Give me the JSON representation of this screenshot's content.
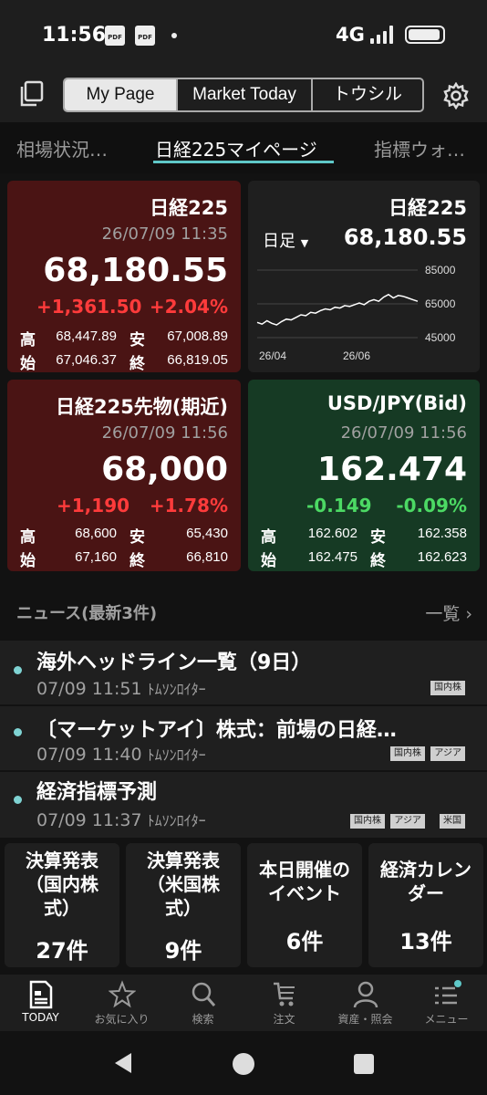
{
  "status_bar": {
    "time": "11:56",
    "network": "4G",
    "pdf_label": "PDF"
  },
  "header": {
    "segments": [
      "My Page",
      "Market Today",
      "トウシル"
    ],
    "active_segment": "My Page"
  },
  "tabs": [
    "相場状況…",
    "日経225マイページ",
    "指標ウォ…"
  ],
  "cards": {
    "nikkei": {
      "name": "日経225",
      "datetime": "26/07/09 11:35",
      "price": "68,180.55",
      "change": "+1,361.50",
      "change_pct": "+2.04%",
      "high_label": "高",
      "high": "68,447.89",
      "low_label": "安",
      "low": "67,008.89",
      "open_label": "始",
      "open": "67,046.37",
      "close_label": "終",
      "close": "66,819.05"
    },
    "nikkei_chart": {
      "name": "日経225",
      "period": "日足",
      "price": "68,180.55",
      "y_ticks": [
        "85000",
        "65000",
        "45000"
      ],
      "x_ticks": [
        "26/04",
        "26/06"
      ]
    },
    "futures": {
      "name": "日経225先物(期近)",
      "datetime": "26/07/09 11:56",
      "price": "68,000",
      "change": "+1,190",
      "change_pct": "+1.78%",
      "high_label": "高",
      "high": "68,600",
      "low_label": "安",
      "low": "65,430",
      "open_label": "始",
      "open": "67,160",
      "close_label": "終",
      "close": "66,810"
    },
    "usdjpy": {
      "name": "USD/JPY(Bid)",
      "datetime": "26/07/09 11:56",
      "price": "162.474",
      "change": "-0.149",
      "change_pct": "-0.09%",
      "high_label": "高",
      "high": "162.602",
      "low_label": "安",
      "low": "162.358",
      "open_label": "始",
      "open": "162.475",
      "close_label": "終",
      "close": "162.623"
    }
  },
  "chart_data": {
    "type": "line",
    "x": [
      "26/04",
      "26/06"
    ],
    "ylim": [
      45000,
      85000
    ],
    "y_ticks": [
      85000,
      65000,
      45000
    ],
    "series": [
      {
        "values": [
          54000,
          53000,
          55000,
          53500,
          52500,
          54500,
          56000,
          55500,
          57000,
          58500,
          58000,
          60000,
          59500,
          61000,
          62000,
          61500,
          63000,
          62500,
          64000,
          63500,
          64500,
          65500,
          64500,
          66500,
          67500,
          66500,
          69000,
          70500,
          68500,
          70000,
          69500,
          68500,
          67500,
          66500
        ]
      }
    ]
  },
  "news": {
    "heading": "ニュース(最新3件)",
    "more": "一覧",
    "items": [
      {
        "title": "海外ヘッドライン一覧（9日）",
        "time": "07/09 11:51",
        "source": "ﾄﾑｿﾝﾛｲﾀｰ",
        "tags": [
          "国内株"
        ]
      },
      {
        "title": "〔マーケットアイ〕株式：前場の日経…",
        "time": "07/09 11:40",
        "source": "ﾄﾑｿﾝﾛｲﾀｰ",
        "tags": [
          "国内株",
          "アジア"
        ]
      },
      {
        "title": "経済指標予測",
        "time": "07/09 11:37",
        "source": "ﾄﾑｿﾝﾛｲﾀｰ",
        "tags": [
          "国内株",
          "アジア",
          "米国"
        ]
      }
    ]
  },
  "tiles": [
    {
      "title": "決算発表\n（国内株\n式）",
      "count": "27件"
    },
    {
      "title": "決算発表\n（米国株\n式）",
      "count": "9件"
    },
    {
      "title": "本日開催の\nイベント",
      "count": "6件"
    },
    {
      "title": "経済カレン\nダー",
      "count": "13件"
    }
  ],
  "bottom_nav": [
    {
      "label": "TODAY",
      "icon": "today-icon"
    },
    {
      "label": "お気に入り",
      "icon": "star-icon"
    },
    {
      "label": "検索",
      "icon": "search-icon"
    },
    {
      "label": "注文",
      "icon": "cart-icon"
    },
    {
      "label": "資産・照会",
      "icon": "person-icon"
    },
    {
      "label": "メニュー",
      "icon": "menu-icon"
    }
  ],
  "colors": {
    "accent": "#5fc8c8",
    "up": "#ff3b3b",
    "down": "#4cd964",
    "red_card": "#4a1414",
    "green_card": "#163a24"
  }
}
